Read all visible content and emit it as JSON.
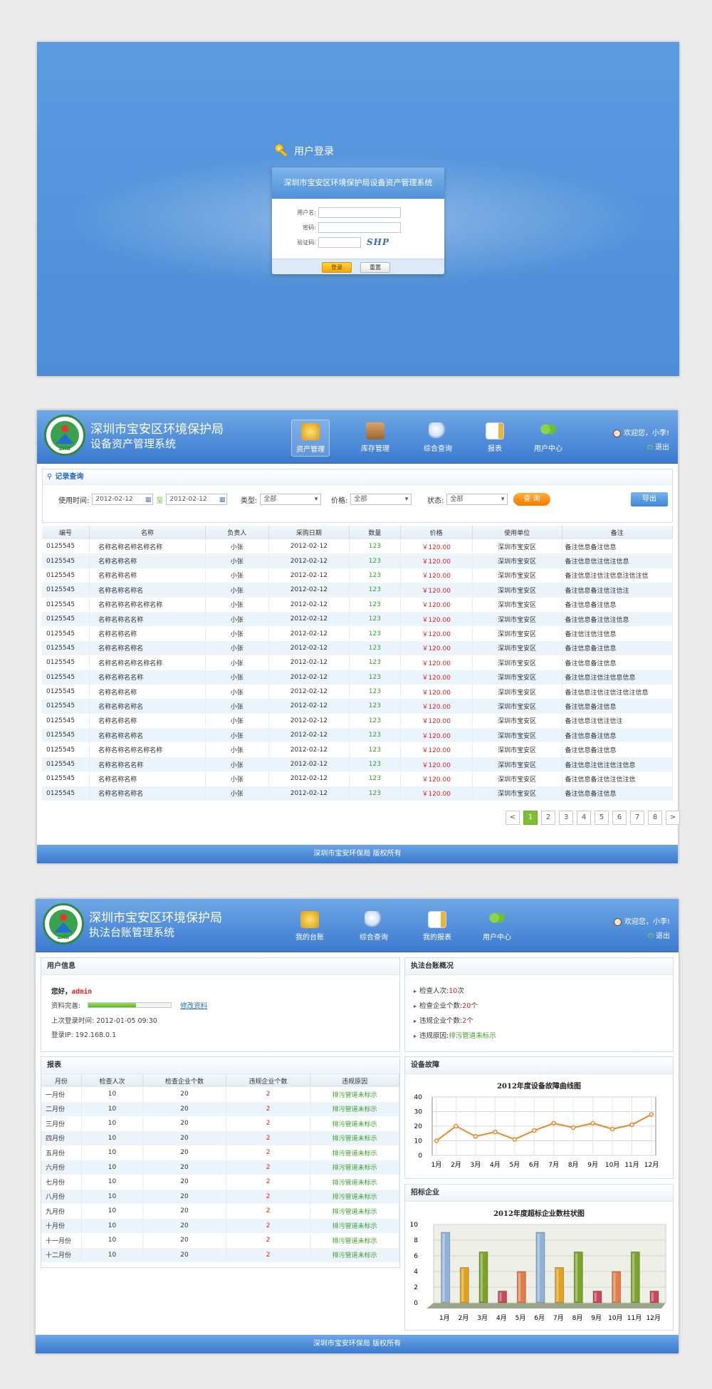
{
  "login": {
    "title": "用户登录",
    "system_name": "深圳市宝安区环境保护局设备资产管理系统",
    "username_label": "用户名:",
    "password_label": "密码:",
    "captcha_label": "验证码:",
    "captcha_text": "SHP",
    "login_button": "登录",
    "reset_button": "重置"
  },
  "asset": {
    "org_name": "深圳市宝安区环境保护局",
    "system_name": "设备资产管理系统",
    "logo_text": "ZHB",
    "nav": [
      {
        "label": "资产管理",
        "icon": "coins-icon",
        "active": true
      },
      {
        "label": "库存管理",
        "icon": "box-icon",
        "active": false
      },
      {
        "label": "综合查询",
        "icon": "magnifier-icon",
        "active": false
      },
      {
        "label": "报表",
        "icon": "report-icon",
        "active": false
      },
      {
        "label": "用户中心",
        "icon": "users-icon",
        "active": false
      }
    ],
    "welcome": "欢迎您，小李!",
    "logout": "退出",
    "query": {
      "title": "记录查询",
      "date_label": "使用时间:",
      "date_from": "2012-02-12",
      "to_label": "至",
      "date_to": "2012-02-12",
      "type_label": "类型:",
      "type_value": "全部",
      "price_label": "价格:",
      "price_value": "全部",
      "status_label": "状态:",
      "status_value": "全部",
      "query_button": "查 询",
      "export_button": "导出"
    },
    "columns": [
      "编号",
      "名称",
      "负责人",
      "采购日期",
      "数量",
      "价格",
      "使用单位",
      "备注"
    ],
    "rows": [
      [
        "0125545",
        "名称名称名称名称名称",
        "小张",
        "2012-02-12",
        "123",
        "￥120.00",
        "深圳市宝安区",
        "备注信息备注信息"
      ],
      [
        "0125545",
        "名称名称名称",
        "小张",
        "2012-02-12",
        "123",
        "￥120.00",
        "深圳市宝安区",
        "备注信息信注信注信息"
      ],
      [
        "0125545",
        "名称名称名称",
        "小张",
        "2012-02-12",
        "123",
        "￥120.00",
        "深圳市宝安区",
        "备注信息注信注信息注信注信"
      ],
      [
        "0125545",
        "名称名称名称名",
        "小张",
        "2012-02-12",
        "123",
        "￥120.00",
        "深圳市宝安区",
        "备注信息备注信注信注"
      ],
      [
        "0125545",
        "名称名称名称名称名称",
        "小张",
        "2012-02-12",
        "123",
        "￥120.00",
        "深圳市宝安区",
        "备注信息备注信息"
      ],
      [
        "0125545",
        "名称名称名名称",
        "小张",
        "2012-02-12",
        "123",
        "￥120.00",
        "深圳市宝安区",
        "备注信息备注信注信息"
      ],
      [
        "0125545",
        "名称名称名称",
        "小张",
        "2012-02-12",
        "123",
        "￥120.00",
        "深圳市宝安区",
        "备注信注信注信息"
      ],
      [
        "0125545",
        "名称名称名称名",
        "小张",
        "2012-02-12",
        "123",
        "￥120.00",
        "深圳市宝安区",
        "备注信息备注信息"
      ],
      [
        "0125545",
        "名称名称名称名称名称",
        "小张",
        "2012-02-12",
        "123",
        "￥120.00",
        "深圳市宝安区",
        "备注信息备注信息"
      ],
      [
        "0125545",
        "名称名称名名称",
        "小张",
        "2012-02-12",
        "123",
        "￥120.00",
        "深圳市宝安区",
        "备注信息注信注信息信息"
      ],
      [
        "0125545",
        "名称名称名称",
        "小张",
        "2012-02-12",
        "123",
        "￥120.00",
        "深圳市宝安区",
        "备注信息注信注信注信注信息"
      ],
      [
        "0125545",
        "名称名称名称名",
        "小张",
        "2012-02-12",
        "123",
        "￥120.00",
        "深圳市宝安区",
        "备注信息备注信息"
      ],
      [
        "0125545",
        "名称名称名称",
        "小张",
        "2012-02-12",
        "123",
        "￥120.00",
        "深圳市宝安区",
        "备注信息注信注信注"
      ],
      [
        "0125545",
        "名称名称名称名",
        "小张",
        "2012-02-12",
        "123",
        "￥120.00",
        "深圳市宝安区",
        "备注信息备注信息"
      ],
      [
        "0125545",
        "名称名称名称名称名称",
        "小张",
        "2012-02-12",
        "123",
        "￥120.00",
        "深圳市宝安区",
        "备注信息备注信息"
      ],
      [
        "0125545",
        "名称名称名名称",
        "小张",
        "2012-02-12",
        "123",
        "￥120.00",
        "深圳市宝安区",
        "备注信息注信注信注信息"
      ],
      [
        "0125545",
        "名称名称名称",
        "小张",
        "2012-02-12",
        "123",
        "￥120.00",
        "深圳市宝安区",
        "备注信息备注信注信注信"
      ],
      [
        "0125545",
        "名称名称名称名",
        "小张",
        "2012-02-12",
        "123",
        "￥120.00",
        "深圳市宝安区",
        "备注信息备注信息"
      ]
    ],
    "pager": [
      "<",
      "1",
      "2",
      "3",
      "4",
      "5",
      "6",
      "7",
      "8",
      ">"
    ],
    "current_page": "1",
    "footer": "深圳市宝安环保局 版权所有"
  },
  "ledger": {
    "org_name": "深圳市宝安区环境保护局",
    "system_name": "执法台账管理系统",
    "logo_text": "ZHB",
    "nav": [
      {
        "label": "我的台账",
        "icon": "coins-icon"
      },
      {
        "label": "综合查询",
        "icon": "magnifier-icon"
      },
      {
        "label": "我的报表",
        "icon": "report-icon"
      },
      {
        "label": "用户中心",
        "icon": "users-icon"
      }
    ],
    "welcome": "欢迎您，小李!",
    "logout": "退出",
    "user_info": {
      "title": "用户信息",
      "greeting_prefix": "您好，",
      "username": "admin",
      "completeness_label": "资料完善:",
      "completeness": 0.58,
      "edit_link": "修改资料",
      "last_login": "上次登录时间: 2012-01-05  09:30",
      "login_ip": "登录IP: 192.168.0.1"
    },
    "overview": {
      "title": "执法台账概况",
      "items": [
        {
          "label": "检查人次:",
          "value": "10",
          "unit": "次"
        },
        {
          "label": "检查企业个数:",
          "value": "20",
          "unit": "个"
        },
        {
          "label": "违规企业个数:",
          "value": "2",
          "unit": "个"
        },
        {
          "label": "违规原因:",
          "value": "排污管道未标示",
          "unit": ""
        }
      ]
    },
    "report": {
      "title": "报表",
      "columns": [
        "月份",
        "检查人次",
        "检查企业个数",
        "违规企业个数",
        "违规原因"
      ],
      "rows": [
        [
          "一月份",
          "10",
          "20",
          "2",
          "排污管道未标示"
        ],
        [
          "二月份",
          "10",
          "20",
          "2",
          "排污管道未标示"
        ],
        [
          "三月份",
          "10",
          "20",
          "2",
          "排污管道未标示"
        ],
        [
          "四月份",
          "10",
          "20",
          "2",
          "排污管道未标示"
        ],
        [
          "五月份",
          "10",
          "20",
          "2",
          "排污管道未标示"
        ],
        [
          "六月份",
          "10",
          "20",
          "2",
          "排污管道未标示"
        ],
        [
          "七月份",
          "10",
          "20",
          "2",
          "排污管道未标示"
        ],
        [
          "八月份",
          "10",
          "20",
          "2",
          "排污管道未标示"
        ],
        [
          "九月份",
          "10",
          "20",
          "2",
          "排污管道未标示"
        ],
        [
          "十月份",
          "10",
          "20",
          "2",
          "排污管道未标示"
        ],
        [
          "十一月份",
          "10",
          "20",
          "2",
          "排污管道未标示"
        ],
        [
          "十二月份",
          "10",
          "20",
          "2",
          "排污管道未标示"
        ]
      ]
    },
    "fault_box_title": "设备故障",
    "bid_box_title": "招标企业",
    "footer": "深圳市宝安环保局 版权所有"
  },
  "chart_data": [
    {
      "type": "line",
      "title": "2012年度设备故障曲线图",
      "categories": [
        "1月",
        "2月",
        "3月",
        "4月",
        "5月",
        "6月",
        "7月",
        "8月",
        "9月",
        "10月",
        "11月",
        "12月"
      ],
      "values": [
        10,
        20,
        13,
        16,
        11,
        17,
        22,
        19,
        22,
        18,
        21,
        28
      ],
      "ylim": [
        0,
        40
      ],
      "yticks": [
        0,
        10,
        20,
        30,
        40
      ],
      "grid": true,
      "color": "#e8892a"
    },
    {
      "type": "bar",
      "title": "2012年度超标企业数柱状图",
      "categories": [
        "1月",
        "2月",
        "3月",
        "4月",
        "5月",
        "6月",
        "7月",
        "8月",
        "9月",
        "10月",
        "11月",
        "12月"
      ],
      "values": [
        9,
        4.5,
        6.5,
        1.5,
        4,
        9,
        4.5,
        6.5,
        1.5,
        4,
        6.5,
        1.5
      ],
      "ylim": [
        0,
        10
      ],
      "yticks": [
        0,
        2,
        4,
        6,
        8,
        10
      ],
      "colors": [
        "#8fb3d9",
        "#e1a21d",
        "#7aa32a",
        "#c94a54",
        "#e07d4a",
        "#8fb3d9",
        "#e1a21d",
        "#7aa32a",
        "#c94a54",
        "#e07d4a",
        "#7aa32a",
        "#c94a54"
      ]
    }
  ]
}
